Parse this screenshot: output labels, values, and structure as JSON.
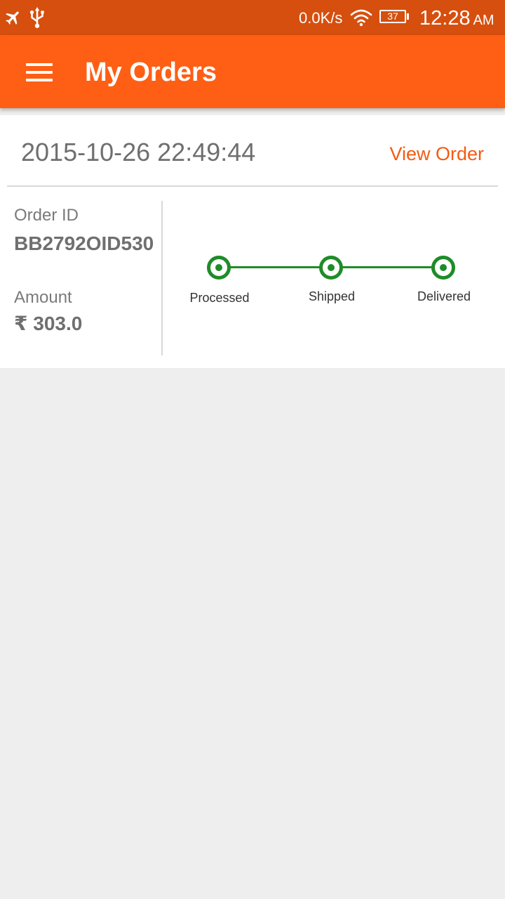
{
  "status_bar": {
    "net_speed": "0.0K/s",
    "battery_level": "37",
    "time": "12:28",
    "ampm": "AM",
    "icons": [
      "airplane-icon",
      "usb-icon",
      "wifi-icon",
      "battery-icon"
    ]
  },
  "app_bar": {
    "title": "My Orders",
    "menu_icon": "hamburger-menu-icon"
  },
  "orders": [
    {
      "date": "2015-10-26 22:49:44",
      "view_label": "View Order",
      "order_id_label": "Order ID",
      "order_id": "BB2792OID530",
      "amount_label": "Amount",
      "amount": "₹ 303.0",
      "steps": [
        {
          "label": "Processed",
          "complete": true
        },
        {
          "label": "Shipped",
          "complete": true
        },
        {
          "label": "Delivered",
          "complete": true
        }
      ]
    }
  ],
  "colors": {
    "status_bar": "#d64f0e",
    "app_bar": "#fe5f14",
    "accent": "#f35b12",
    "step_complete": "#1f8c28",
    "background": "#eeeeee"
  }
}
